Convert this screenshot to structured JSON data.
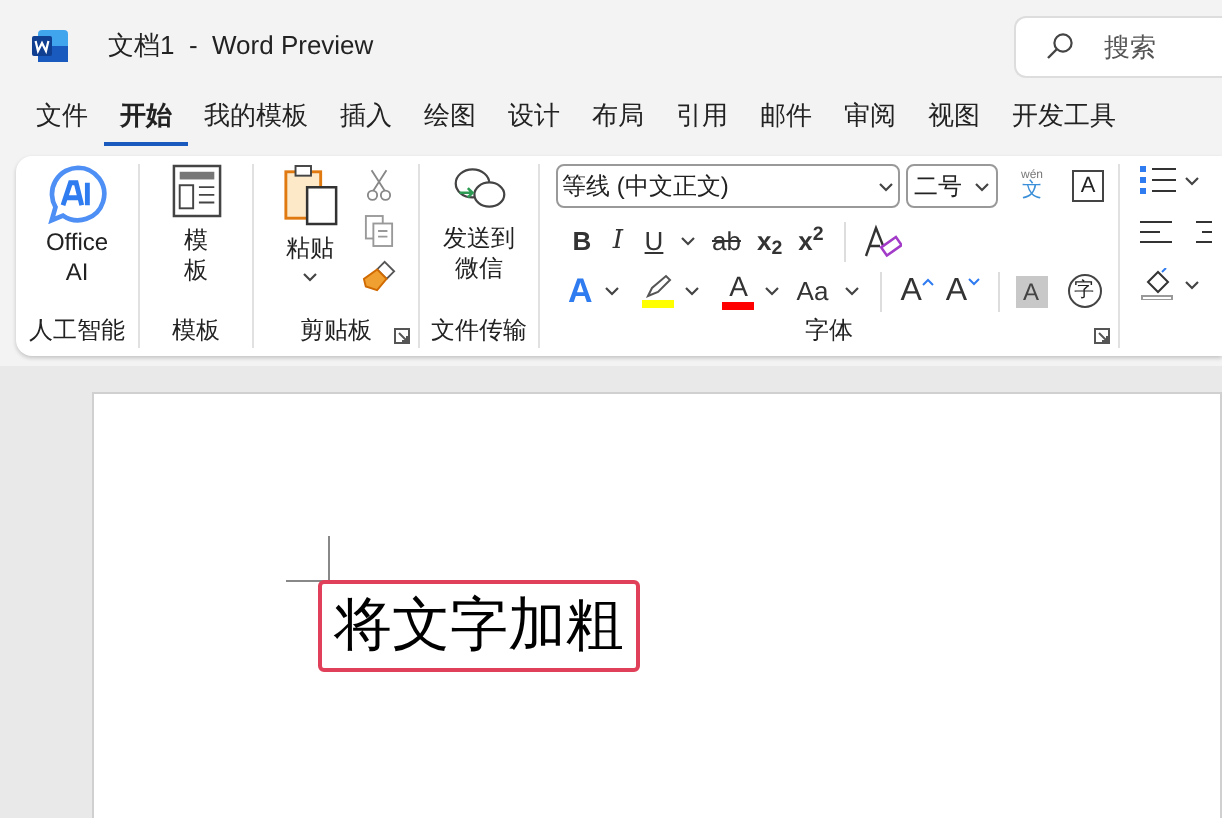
{
  "window": {
    "title": "文档1  -  Word Preview"
  },
  "search": {
    "placeholder": "搜索"
  },
  "tabs": [
    {
      "label": "文件",
      "selected": false
    },
    {
      "label": "开始",
      "selected": true
    },
    {
      "label": "我的模板",
      "selected": false
    },
    {
      "label": "插入",
      "selected": false
    },
    {
      "label": "绘图",
      "selected": false
    },
    {
      "label": "设计",
      "selected": false
    },
    {
      "label": "布局",
      "selected": false
    },
    {
      "label": "引用",
      "selected": false
    },
    {
      "label": "邮件",
      "selected": false
    },
    {
      "label": "审阅",
      "selected": false
    },
    {
      "label": "视图",
      "selected": false
    },
    {
      "label": "开发工具",
      "selected": false
    }
  ],
  "ai_group": {
    "label": "人工智能",
    "button": "Office AI"
  },
  "template_group": {
    "label": "模板",
    "button": "模板"
  },
  "clipboard_group": {
    "label": "剪贴板",
    "paste": "粘贴"
  },
  "transfer_group": {
    "label": "文件传输",
    "button": "发送到微信"
  },
  "font_group": {
    "label": "字体",
    "font_name": "等线 (中文正文)",
    "font_size": "二号",
    "phonetic_ruby": "wén",
    "phonetic_char": "文",
    "char_border": "A",
    "row_2": [
      {
        "kind": "bold",
        "label": "B"
      },
      {
        "kind": "italic",
        "label": "I"
      },
      {
        "kind": "underline",
        "label": "U"
      },
      {
        "kind": "caret"
      },
      {
        "kind": "strike",
        "label": "ab"
      },
      {
        "kind": "subscript",
        "label": "x$_{2}$"
      },
      {
        "kind": "superscript",
        "label": "x$^{2}$"
      },
      {
        "kind": "sep"
      },
      {
        "kind": "clear"
      }
    ],
    "row_3": [
      {
        "kind": "effect",
        "label": "A"
      },
      {
        "kind": "caret"
      },
      {
        "kind": "highlight",
        "color": "#ffff00"
      },
      {
        "kind": "caret"
      },
      {
        "kind": "fontcolor",
        "label": "A",
        "color": "#ff0000"
      },
      {
        "kind": "caret"
      },
      {
        "kind": "case",
        "label": "Aa"
      },
      {
        "kind": "caret"
      },
      {
        "kind": "sep"
      },
      {
        "kind": "grow",
        "label": "A"
      },
      {
        "kind": "shrink",
        "label": "A"
      },
      {
        "kind": "sep"
      },
      {
        "kind": "shaded",
        "label": "A"
      },
      {
        "kind": "circled",
        "label": "字"
      }
    ]
  },
  "document": {
    "text": "将文字加粗"
  }
}
